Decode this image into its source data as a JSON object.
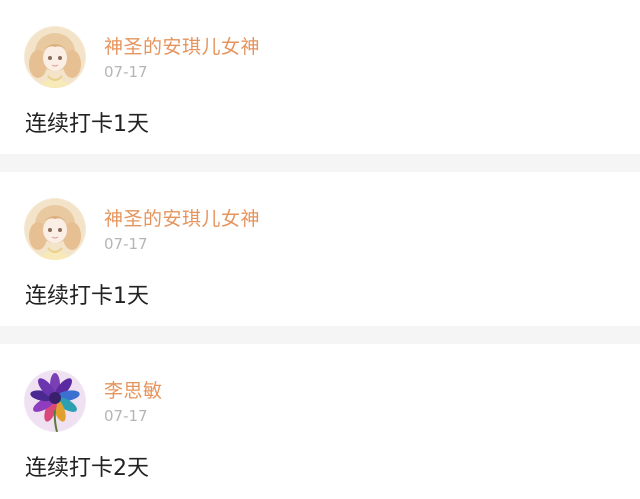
{
  "posts": [
    {
      "user": "神圣的安琪儿女神",
      "date": "07-17",
      "text": "连续打卡1天",
      "avatar_icon": "anime-girl-avatar-icon"
    },
    {
      "user": "神圣的安琪儿女神",
      "date": "07-17",
      "text": "连续打卡1天",
      "avatar_icon": "anime-girl-avatar-icon"
    },
    {
      "user": "李思敏",
      "date": "07-17",
      "text": "连续打卡2天",
      "avatar_icon": "purple-flower-avatar-icon"
    }
  ],
  "colors": {
    "username": "#e6945d",
    "date": "#b5b5b5",
    "text": "#222222",
    "separator": "#f5f5f5"
  }
}
